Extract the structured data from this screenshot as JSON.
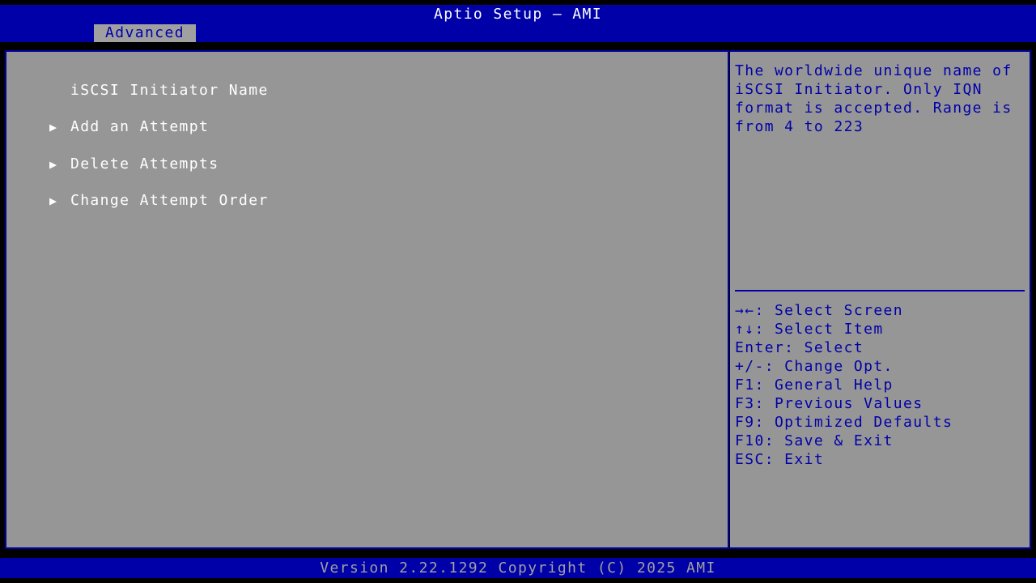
{
  "header": {
    "title": "Aptio Setup – AMI",
    "tab_label": "Advanced"
  },
  "menu": {
    "items": [
      {
        "arrow": "",
        "label": "iSCSI Initiator Name"
      },
      {
        "arrow": "▶",
        "label": "Add an Attempt"
      },
      {
        "arrow": "▶",
        "label": "Delete Attempts"
      },
      {
        "arrow": "▶",
        "label": "Change Attempt Order"
      }
    ]
  },
  "help": {
    "text": "The worldwide unique name of iSCSI Initiator. Only IQN format is accepted. Range is from 4 to 223"
  },
  "keys": [
    "→←: Select Screen",
    "↑↓: Select Item",
    "Enter: Select",
    "+/-: Change Opt.",
    "F1: General Help",
    "F3: Previous Values",
    "F9: Optimized Defaults",
    "F10: Save & Exit",
    "ESC: Exit"
  ],
  "footer": {
    "text": "Version 2.22.1292 Copyright (C) 2025 AMI"
  },
  "colors": {
    "bios_blue": "#0000a8",
    "panel_gray": "#969696",
    "highlight_white": "#ffffff"
  }
}
